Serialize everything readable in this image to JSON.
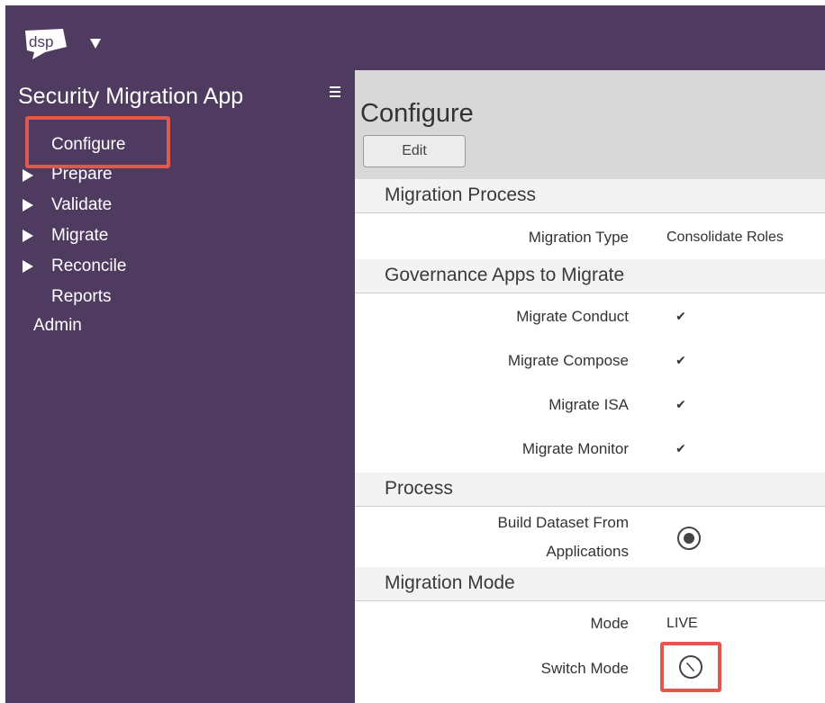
{
  "logo": {
    "text": "dsp"
  },
  "sidebar": {
    "app_title": "Security Migration App",
    "menu_icon": "hamburger-icon",
    "items": [
      {
        "label": "Configure",
        "has_arrow": false,
        "selected": true
      },
      {
        "label": "Prepare",
        "has_arrow": true
      },
      {
        "label": "Validate",
        "has_arrow": true
      },
      {
        "label": "Migrate",
        "has_arrow": true
      },
      {
        "label": "Reconcile",
        "has_arrow": true
      },
      {
        "label": "Reports",
        "has_arrow": false
      },
      {
        "label": "Admin",
        "has_arrow": false
      }
    ]
  },
  "main": {
    "title": "Configure",
    "edit_label": "Edit",
    "sections": {
      "migration_process": {
        "title": "Migration Process",
        "rows": [
          {
            "label": "Migration Type",
            "value": "Consolidate Roles"
          }
        ]
      },
      "governance_apps": {
        "title": "Governance Apps to Migrate",
        "rows": [
          {
            "label": "Migrate Conduct",
            "checked": true
          },
          {
            "label": "Migrate Compose",
            "checked": true
          },
          {
            "label": "Migrate ISA",
            "checked": true
          },
          {
            "label": "Migrate Monitor",
            "checked": true
          }
        ]
      },
      "process": {
        "title": "Process",
        "rows": [
          {
            "label_line1": "Build Dataset From",
            "label_line2": "Applications"
          }
        ]
      },
      "migration_mode": {
        "title": "Migration Mode",
        "rows": [
          {
            "label": "Mode",
            "value": "LIVE"
          },
          {
            "label": "Switch Mode"
          }
        ]
      }
    }
  },
  "colors": {
    "sidebar_bg": "#4f3b60",
    "highlight": "#e0584e",
    "header_bg": "#d8d8d8"
  }
}
